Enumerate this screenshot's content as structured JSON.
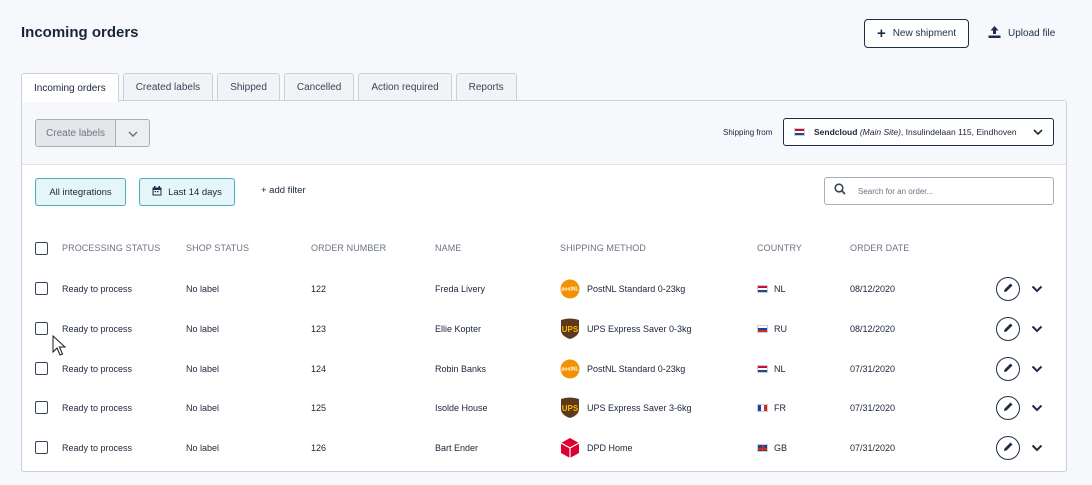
{
  "header": {
    "title": "Incoming orders",
    "new_shipment_label": "New shipment",
    "upload_file_label": "Upload file"
  },
  "tabs": [
    {
      "label": "Incoming orders",
      "active": true
    },
    {
      "label": "Created labels",
      "active": false
    },
    {
      "label": "Shipped",
      "active": false
    },
    {
      "label": "Cancelled",
      "active": false
    },
    {
      "label": "Action required",
      "active": false
    },
    {
      "label": "Reports",
      "active": false
    }
  ],
  "toolbar": {
    "create_labels": "Create labels",
    "shipping_from_label": "Shipping from",
    "shipping_from": {
      "flag": "NL",
      "name": "Sendcloud",
      "site": "(Main Site)",
      "address": ", Insulindelaan 115, Eindhoven"
    }
  },
  "filters": {
    "integrations": "All integrations",
    "date_range": "Last 14 days",
    "add_filter": "+ add filter",
    "search_placeholder": "Search for an order..."
  },
  "table": {
    "columns": [
      "PROCESSING STATUS",
      "SHOP STATUS",
      "ORDER NUMBER",
      "NAME",
      "SHIPPING METHOD",
      "COUNTRY",
      "ORDER DATE"
    ],
    "rows": [
      {
        "processing_status": "Ready to process",
        "shop_status": "No label",
        "order_number": "122",
        "name": "Freda Livery",
        "carrier": "postnl",
        "shipping_method": "PostNL Standard 0-23kg",
        "country": "NL",
        "order_date": "08/12/2020"
      },
      {
        "processing_status": "Ready to process",
        "shop_status": "No label",
        "order_number": "123",
        "name": "Ellie Kopter",
        "carrier": "ups",
        "shipping_method": "UPS Express Saver 0-3kg",
        "country": "RU",
        "order_date": "08/12/2020"
      },
      {
        "processing_status": "Ready to process",
        "shop_status": "No label",
        "order_number": "124",
        "name": "Robin Banks",
        "carrier": "postnl",
        "shipping_method": "PostNL Standard 0-23kg",
        "country": "NL",
        "order_date": "07/31/2020"
      },
      {
        "processing_status": "Ready to process",
        "shop_status": "No label",
        "order_number": "125",
        "name": "Isolde House",
        "carrier": "ups",
        "shipping_method": "UPS Express Saver 3-6kg",
        "country": "FR",
        "order_date": "07/31/2020"
      },
      {
        "processing_status": "Ready to process",
        "shop_status": "No label",
        "order_number": "126",
        "name": "Bart Ender",
        "carrier": "dpd",
        "shipping_method": "DPD Home",
        "country": "GB",
        "order_date": "07/31/2020"
      }
    ]
  },
  "logos": {
    "postnl": "postNL",
    "ups": "UPS"
  },
  "colors": {
    "accent": "#1d2d46",
    "filter_border": "#3fb1c4",
    "filter_bg": "#e5f5f8",
    "postnl": "#f39200",
    "ups": "#5a3a1b",
    "ups_gold": "#ffb500",
    "dpd": "#dc0032"
  }
}
